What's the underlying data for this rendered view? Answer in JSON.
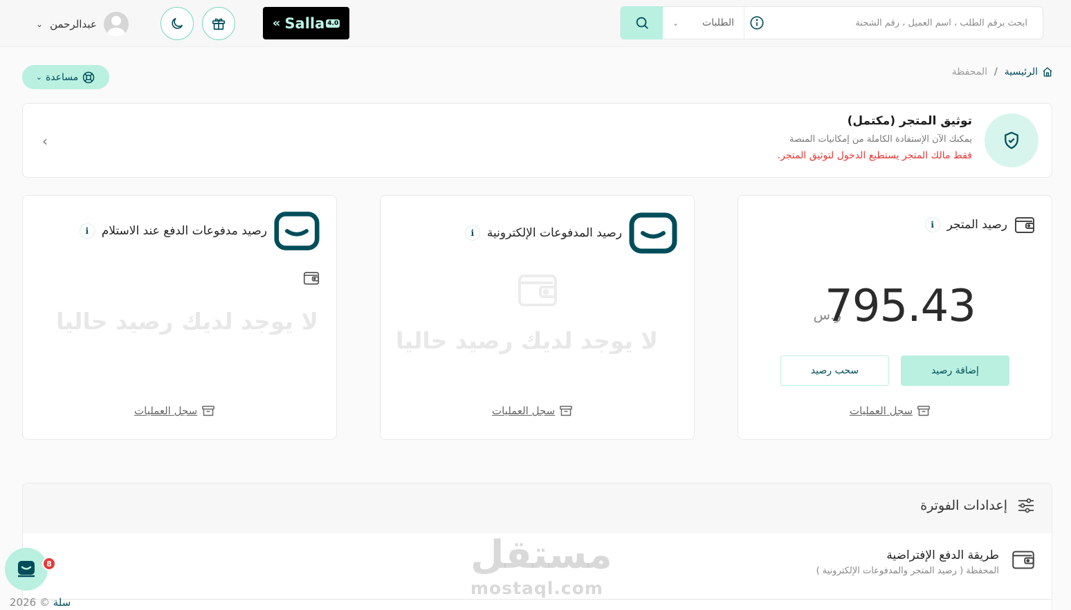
{
  "header": {
    "search_placeholder": "ابحث برقم الطلب ، اسم العميل ، رقم الشحنة",
    "search_scope": "الطلبات",
    "logo_text": "Salla",
    "logo_version": "4.0",
    "user_name": "عبدالرحمن"
  },
  "help": {
    "label": "مساعدة"
  },
  "breadcrumb": {
    "home": "الرئيسية",
    "separator": "/",
    "current": "المحفظة"
  },
  "verification": {
    "title": "توثيق المتجر (مكتمل)",
    "subtitle": "يمكنك الآن الإستفادة الكاملة من إمكانيات المنصة",
    "warning": "فقط مالك المتجر يستطيع الدخول لتوثيق المتجر."
  },
  "balances": {
    "store": {
      "title": "رصيد المتجر",
      "amount": "795.43",
      "currency": "ر.س",
      "add_label": "إضافة رصيد",
      "withdraw_label": "سحب رصيد",
      "ops_label": "سجل العمليات"
    },
    "electronic": {
      "title": "رصيد المدفوعات الإلكترونية",
      "empty": "لا يوجد لديك رصيد حاليا",
      "ops_label": "سجل العمليات"
    },
    "cod": {
      "title": "رصيد مدفوعات الدفع عند الاستلام",
      "empty": "لا يوجد لديك رصيد حاليا",
      "ops_label": "سجل العمليات"
    }
  },
  "invoice": {
    "title": "إعدادات الفوترة",
    "method_title": "طريقة الدفع الإفتراضية",
    "method_value": "المحفظة ( رصيد المتجر والمدفوعات الإلكترونية )"
  },
  "watermark": {
    "ar": "مستقل",
    "en": "mostaql.com"
  },
  "chat": {
    "badge": "8"
  },
  "footer": {
    "year": "2026 ©",
    "brand": "سلة"
  },
  "colors": {
    "brand": "#004d5a",
    "accent": "#b9f0e0",
    "danger": "#e53935"
  }
}
